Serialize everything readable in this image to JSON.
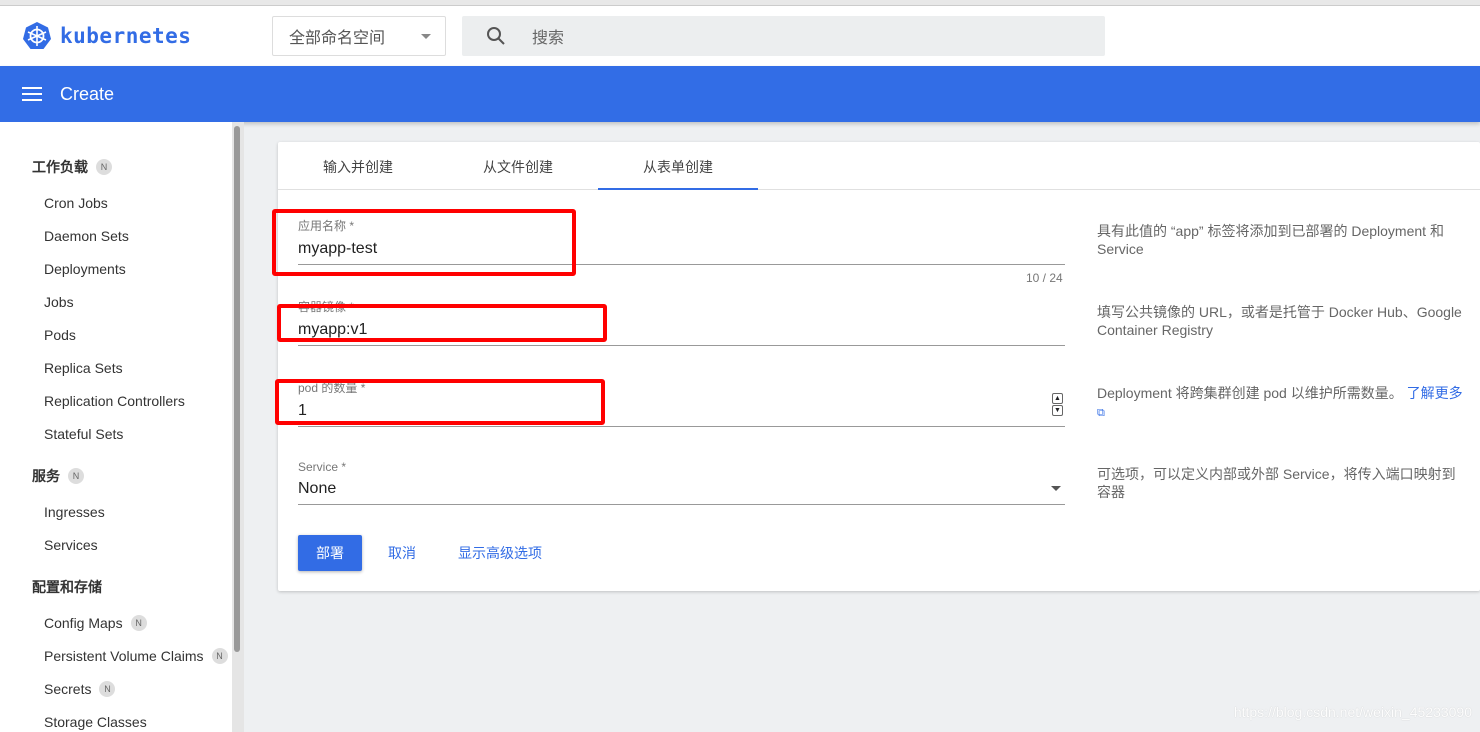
{
  "header": {
    "logo_text": "kubernetes",
    "namespace": "全部命名空间",
    "search_placeholder": "搜索"
  },
  "toolbar": {
    "title": "Create"
  },
  "sidebar": {
    "sections": [
      {
        "label": "工作负载",
        "badge": "N",
        "items": [
          {
            "label": "Cron Jobs"
          },
          {
            "label": "Daemon Sets"
          },
          {
            "label": "Deployments"
          },
          {
            "label": "Jobs"
          },
          {
            "label": "Pods"
          },
          {
            "label": "Replica Sets"
          },
          {
            "label": "Replication Controllers"
          },
          {
            "label": "Stateful Sets"
          }
        ]
      },
      {
        "label": "服务",
        "badge": "N",
        "items": [
          {
            "label": "Ingresses"
          },
          {
            "label": "Services"
          }
        ]
      },
      {
        "label": "配置和存储",
        "items": [
          {
            "label": "Config Maps",
            "badge": "N"
          },
          {
            "label": "Persistent Volume Claims",
            "badge": "N"
          },
          {
            "label": "Secrets",
            "badge": "N"
          },
          {
            "label": "Storage Classes"
          }
        ]
      }
    ]
  },
  "tabs": [
    {
      "label": "输入并创建"
    },
    {
      "label": "从文件创建"
    },
    {
      "label": "从表单创建",
      "active": true
    }
  ],
  "form": {
    "app_name": {
      "label": "应用名称 *",
      "value": "myapp-test",
      "counter": "10 / 24",
      "hint": "具有此值的 “app” 标签将添加到已部署的 Deployment 和 Service"
    },
    "image": {
      "label": "容器镜像 *",
      "value": "myapp:v1",
      "hint": "填写公共镜像的 URL，或者是托管于 Docker Hub、Google Container Registry"
    },
    "pods": {
      "label": "pod 的数量 *",
      "value": "1",
      "hint": "Deployment 将跨集群创建 pod 以维护所需数量。",
      "link": "了解更多"
    },
    "service": {
      "label": "Service *",
      "value": "None",
      "hint": "可选项，可以定义内部或外部 Service，将传入端口映射到容器"
    },
    "deploy": "部署",
    "cancel": "取消",
    "advanced": "显示高级选项"
  },
  "colors": {
    "brand": "#326ce5",
    "highlight": "#ff0000"
  },
  "watermark": "https://blog.csdn.net/weixin_45233090"
}
